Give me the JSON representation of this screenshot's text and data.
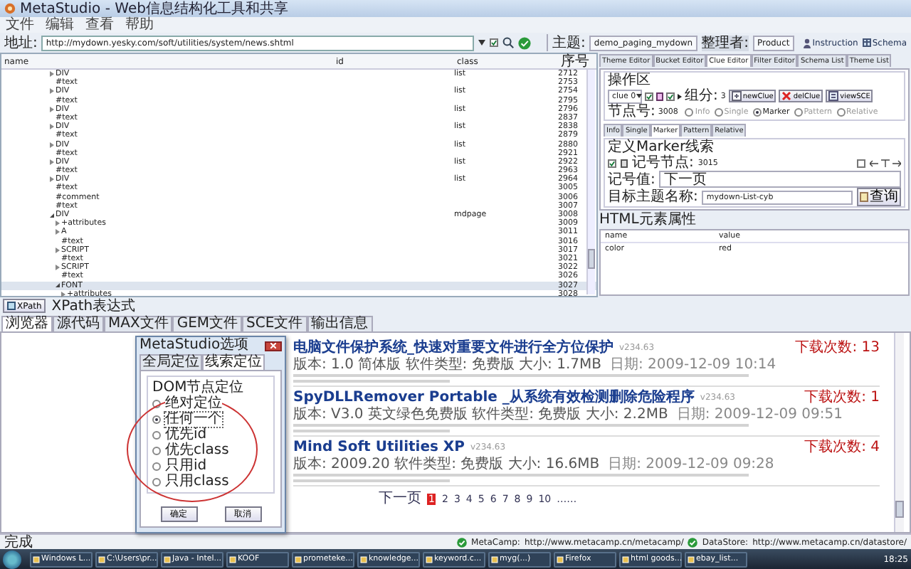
{
  "window": {
    "title": "MetaStudio - Web信息结构化工具和共享"
  },
  "menu": [
    "文件",
    "编辑",
    "查看",
    "帮助"
  ],
  "address": {
    "label": "地址:",
    "url": "http://mydown.yesky.com/soft/utilities/system/news.shtml",
    "option_checked": true
  },
  "theme": {
    "label": "主题:",
    "value": "demo_paging_mydown",
    "owner_label": "整理者:",
    "owner": "Product",
    "links": [
      "Instruction",
      "Schema"
    ]
  },
  "tree": {
    "columns": [
      "name",
      "id",
      "class",
      "序号"
    ],
    "rows": [
      {
        "name": "DIV",
        "class": "list",
        "number": "2712",
        "kind": "collapsed",
        "selected": false
      },
      {
        "name": "#text",
        "number": "2753",
        "kind": "leaf",
        "selected": false
      },
      {
        "name": "DIV",
        "class": "list",
        "number": "2754",
        "kind": "collapsed",
        "selected": false
      },
      {
        "name": "#text",
        "number": "2795",
        "kind": "leaf",
        "selected": false
      },
      {
        "name": "DIV",
        "class": "list",
        "number": "2796",
        "kind": "collapsed",
        "selected": false
      },
      {
        "name": "#text",
        "number": "2837",
        "kind": "leaf",
        "selected": false
      },
      {
        "name": "DIV",
        "class": "list",
        "number": "2838",
        "kind": "collapsed",
        "selected": false
      },
      {
        "name": "#text",
        "number": "2879",
        "kind": "leaf",
        "selected": false
      },
      {
        "name": "DIV",
        "class": "list",
        "number": "2880",
        "kind": "collapsed",
        "selected": false
      },
      {
        "name": "#text",
        "number": "2921",
        "kind": "leaf",
        "selected": false
      },
      {
        "name": "DIV",
        "class": "list",
        "number": "2922",
        "kind": "collapsed",
        "selected": false
      },
      {
        "name": "#text",
        "number": "2963",
        "kind": "leaf",
        "selected": false
      },
      {
        "name": "DIV",
        "class": "list",
        "number": "2964",
        "kind": "collapsed",
        "selected": false
      },
      {
        "name": "#text",
        "number": "3005",
        "kind": "leaf",
        "selected": false
      },
      {
        "name": "#comment",
        "number": "3006",
        "kind": "leaf",
        "selected": false
      },
      {
        "name": "#text",
        "number": "3007",
        "kind": "leaf",
        "selected": false
      },
      {
        "name": "DIV",
        "class": "mdpage",
        "number": "3008",
        "kind": "expanded",
        "selected": false,
        "children": [
          {
            "name": "+attributes",
            "number": "3009",
            "kind": "collapsed",
            "selected": false
          },
          {
            "name": "A",
            "number": "3011",
            "kind": "collapsed",
            "selected": false
          },
          {
            "name": "#text",
            "number": "3016",
            "kind": "leaf",
            "selected": false
          },
          {
            "name": "SCRIPT",
            "number": "3017",
            "kind": "collapsed",
            "selected": false
          },
          {
            "name": "#text",
            "number": "3021",
            "kind": "leaf",
            "selected": false
          },
          {
            "name": "SCRIPT",
            "number": "3022",
            "kind": "collapsed",
            "selected": false
          },
          {
            "name": "#text",
            "number": "3026",
            "kind": "leaf",
            "selected": false
          },
          {
            "name": "FONT",
            "number": "3027",
            "kind": "expanded",
            "selected": true,
            "children": [
              {
                "name": "+attributes",
                "number": "3028",
                "kind": "collapsed",
                "selected": false
              }
            ]
          }
        ]
      }
    ]
  },
  "editor_tabs": [
    {
      "label": "Theme Editor",
      "selected": false
    },
    {
      "label": "Bucket Editor",
      "selected": false
    },
    {
      "label": "Clue Editor",
      "selected": true
    },
    {
      "label": "Filter Editor",
      "selected": false
    },
    {
      "label": "Schema List",
      "selected": false
    },
    {
      "label": "Theme List",
      "selected": false
    }
  ],
  "operations": {
    "title": "操作区",
    "clue": "clue 0",
    "checks": [
      {
        "checked": true
      },
      {
        "checked": true
      }
    ],
    "count_label": "组分:",
    "count": "3",
    "buttons": [
      "newClue",
      "delClue",
      "viewSCE"
    ]
  },
  "node": {
    "label": "节点号:",
    "value": "3008",
    "modes": [
      {
        "label": "Info",
        "selected": false
      },
      {
        "label": "Single",
        "selected": false
      },
      {
        "label": "Marker",
        "selected": true
      },
      {
        "label": "Pattern",
        "selected": false
      },
      {
        "label": "Relative",
        "selected": false
      }
    ]
  },
  "sub_tabs": [
    {
      "label": "Info",
      "selected": false
    },
    {
      "label": "Single",
      "selected": false
    },
    {
      "label": "Marker",
      "selected": true
    },
    {
      "label": "Pattern",
      "selected": false
    },
    {
      "label": "Relative",
      "selected": false
    }
  ],
  "marker": {
    "title": "定义Marker线索",
    "checked": true,
    "node_label": "记号节点:",
    "node": "3015",
    "arrow_checked": false,
    "value_label": "记号值:",
    "value": "下一页",
    "target_label": "目标主题名称:",
    "target": "mydown-List-cyb",
    "query": "查询"
  },
  "attributes": {
    "title": "HTML元素属性",
    "columns": [
      "name",
      "value"
    ],
    "rows": [
      [
        "color",
        "red"
      ]
    ]
  },
  "xpath": {
    "button": "XPath",
    "label": "XPath表达式"
  },
  "bottom_tabs": [
    {
      "label": "浏览器",
      "selected": true
    },
    {
      "label": "源代码",
      "selected": false
    },
    {
      "label": "MAX文件",
      "selected": false
    },
    {
      "label": "GEM文件",
      "selected": false
    },
    {
      "label": "SCE文件",
      "selected": false
    },
    {
      "label": "输出信息",
      "selected": false
    }
  ],
  "dialog": {
    "title": "MetaStudio选项",
    "tabs": [
      {
        "label": "全局定位",
        "selected": false
      },
      {
        "label": "线索定位",
        "selected": true
      }
    ],
    "group": "DOM节点定位",
    "options": [
      {
        "label": "绝对定位",
        "selected": false
      },
      {
        "label": "任何一个",
        "selected": true
      },
      {
        "label": "优先id",
        "selected": false
      },
      {
        "label": "优先class",
        "selected": false
      },
      {
        "label": "只用id",
        "selected": false
      },
      {
        "label": "只用class",
        "selected": false
      }
    ],
    "buttons": [
      "确定",
      "取消"
    ]
  },
  "results": [
    {
      "title": "电脑文件保护系统_快速对重要文件进行全方位保护",
      "version": "v234.63",
      "meta": "版本: 1.0 简体版 软件类型: 免费版 大小: 1.7MB",
      "date": "日期: 2009-12-09 10:14",
      "downloads": "下载次数: 13"
    },
    {
      "title": "SpyDLLRemover Portable _从系统有效检测删除危险程序",
      "version": "v234.63",
      "meta": "版本: V3.0 英文绿色免费版 软件类型: 免费版 大小: 2.2MB",
      "date": "日期: 2009-12-09 09:51",
      "downloads": "下载次数: 1"
    },
    {
      "title": "Mind Soft Utilities XP",
      "version": "v234.63",
      "meta": "版本: 2009.20 软件类型: 免费版 大小: 16.6MB",
      "date": "日期: 2009-12-09 09:28",
      "downloads": "下载次数: 4"
    }
  ],
  "pager": {
    "next": "下一页",
    "pages": [
      {
        "label": "1",
        "selected": true
      },
      {
        "label": "2",
        "selected": false
      },
      {
        "label": "3",
        "selected": false
      },
      {
        "label": "4",
        "selected": false
      },
      {
        "label": "5",
        "selected": false
      },
      {
        "label": "6",
        "selected": false
      },
      {
        "label": "7",
        "selected": false
      },
      {
        "label": "8",
        "selected": false
      },
      {
        "label": "9",
        "selected": false
      },
      {
        "label": "10",
        "selected": false
      }
    ],
    "more": "……"
  },
  "status": {
    "text": "完成",
    "links": [
      {
        "label": "MetaCamp:",
        "url": "http://www.metacamp.cn/metacamp/"
      },
      {
        "label": "DataStore:",
        "url": "http://www.metacamp.cn/datastore/"
      }
    ]
  },
  "taskbar": {
    "items": [
      "Windows L...",
      "C:\\Users\\pr...",
      "Java - Intel...",
      "KOOF",
      "prometeke...",
      "knowledge...",
      "keyword.c...",
      "myg(...)",
      "Firefox",
      "html goods...",
      "ebay_list..."
    ],
    "clock": "18:25"
  }
}
